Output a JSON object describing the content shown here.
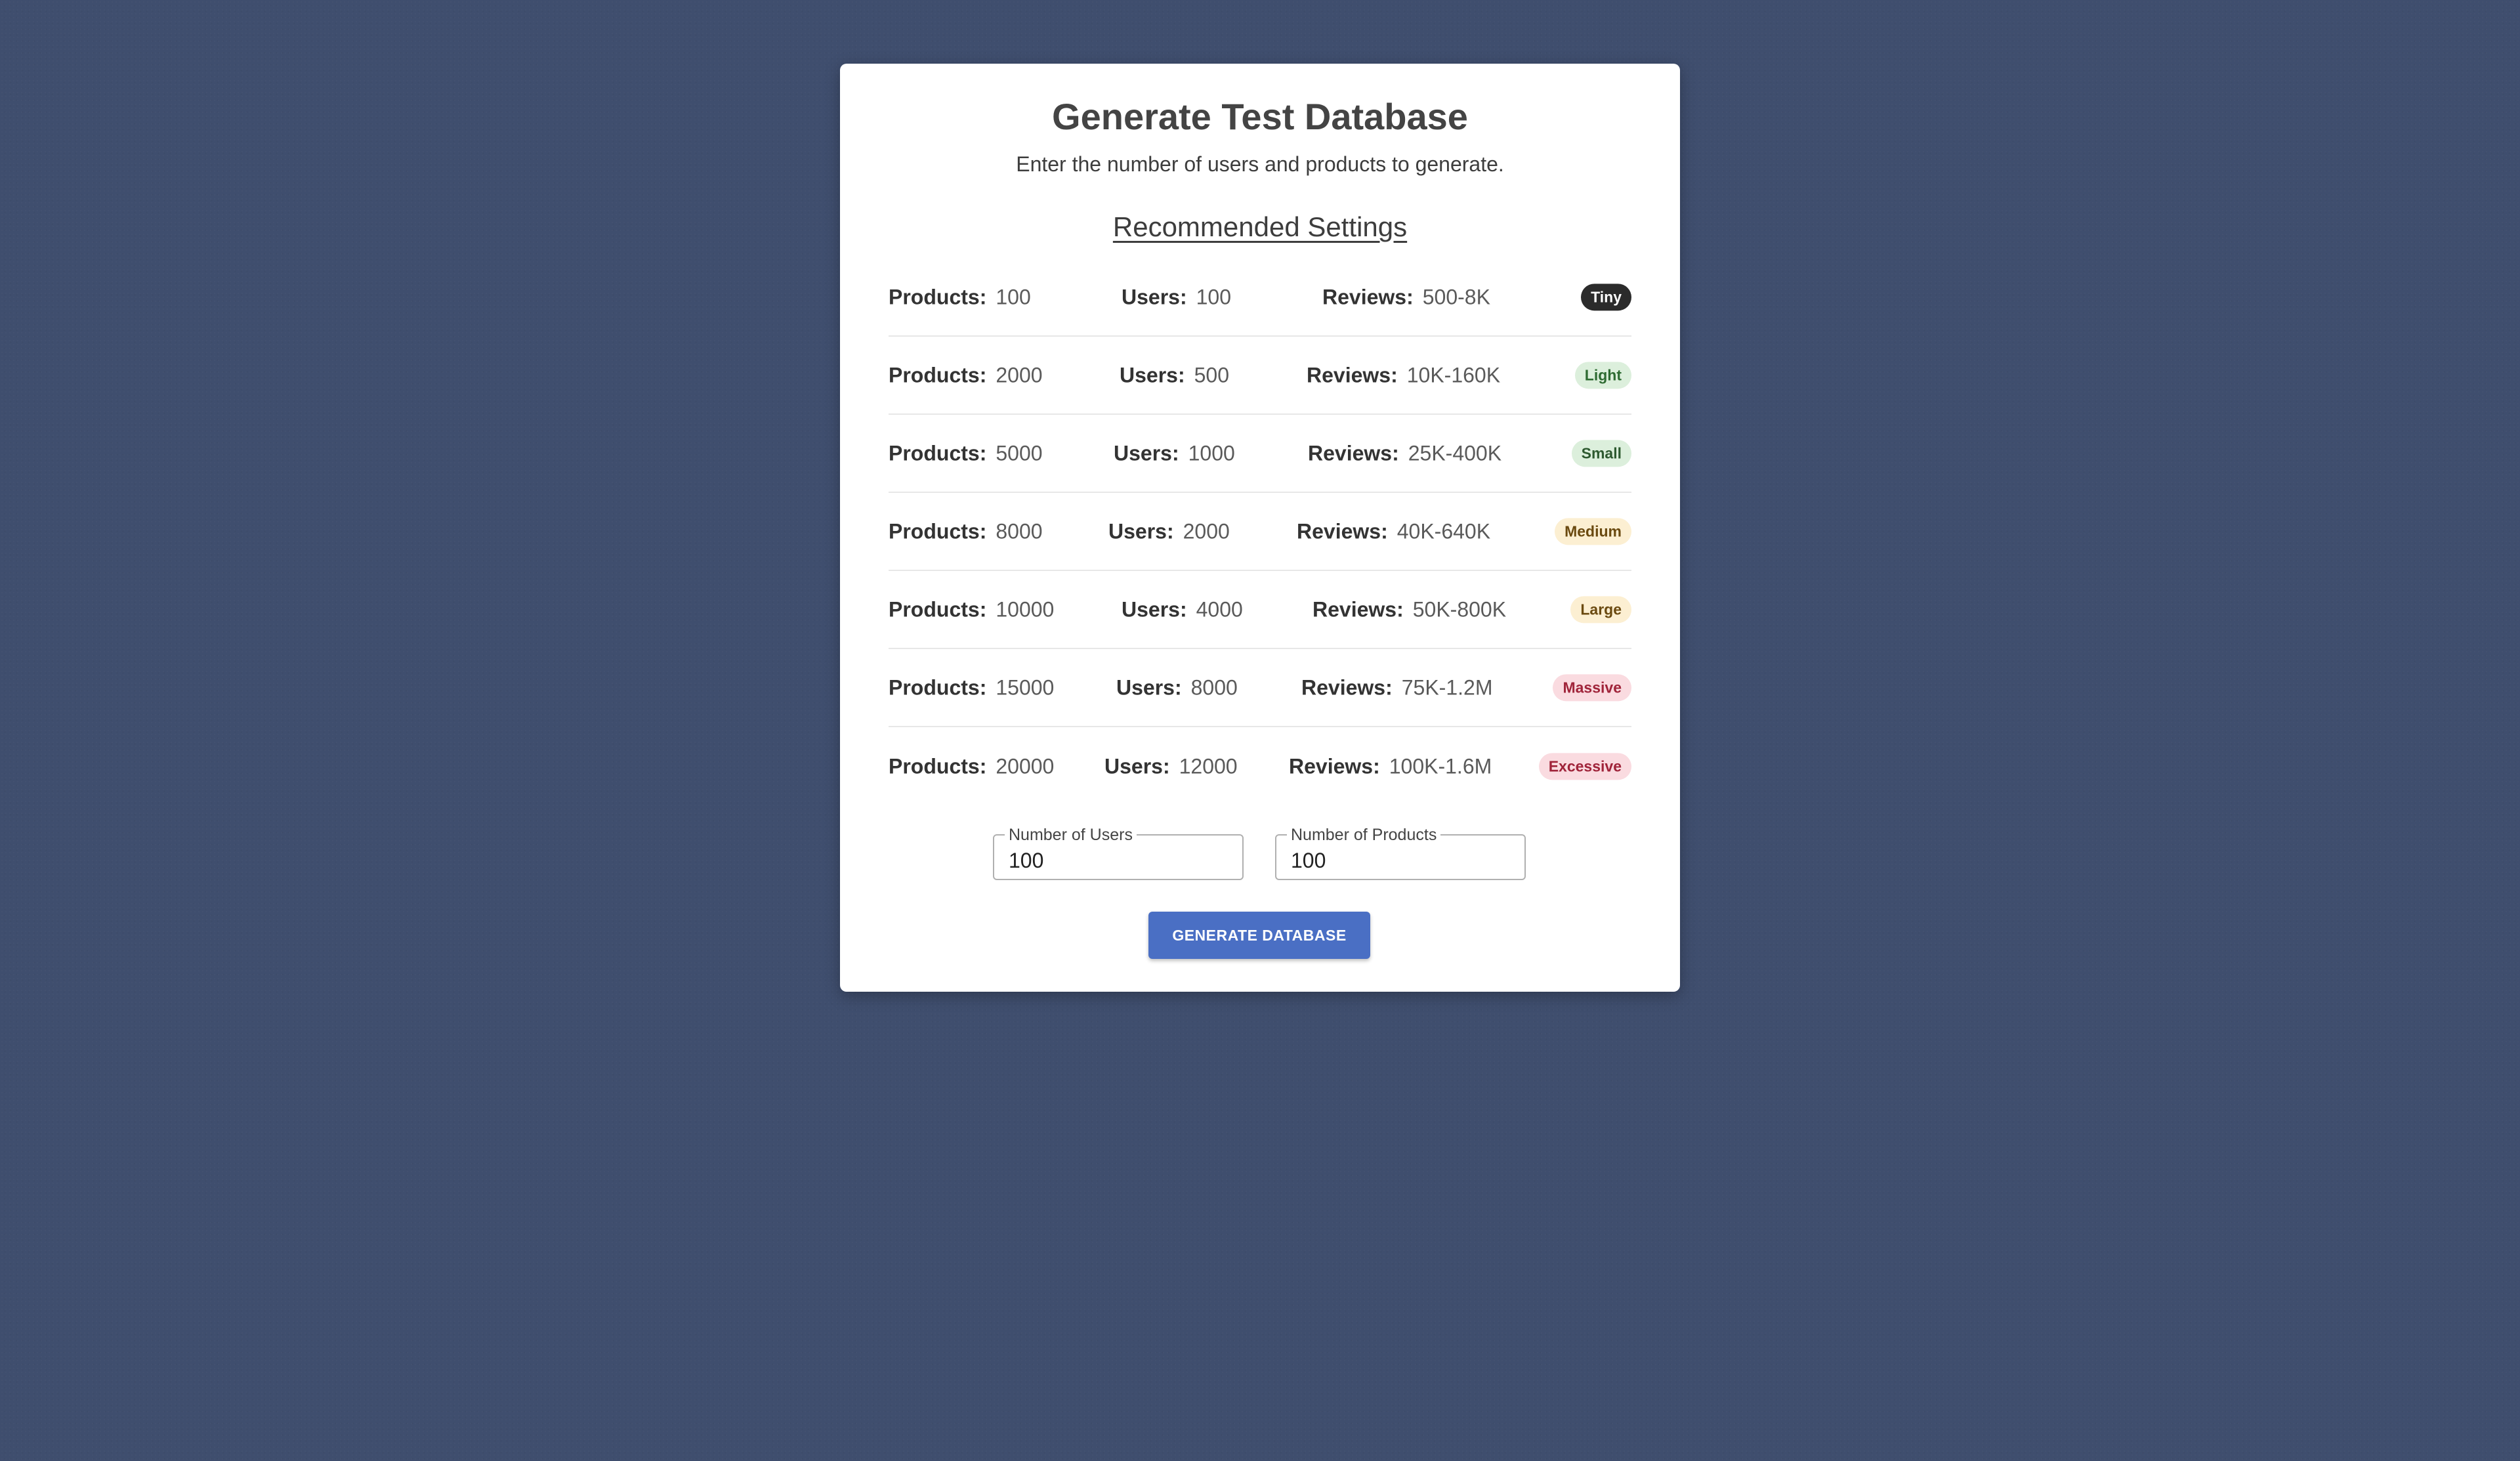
{
  "page": {
    "title": "Generate Test Database",
    "subtitle": "Enter the number of users and products to generate.",
    "section_title": "Recommended Settings"
  },
  "labels": {
    "products": "Products:",
    "users": "Users:",
    "reviews": "Reviews:"
  },
  "settings": [
    {
      "products": "100",
      "users": "100",
      "reviews": "500-8K",
      "size": "Tiny",
      "badge_bg": "#2b2b2b",
      "badge_fg": "#ffffff"
    },
    {
      "products": "2000",
      "users": "500",
      "reviews": "10K-160K",
      "size": "Light",
      "badge_bg": "#dcefdc",
      "badge_fg": "#2e6b32"
    },
    {
      "products": "5000",
      "users": "1000",
      "reviews": "25K-400K",
      "size": "Small",
      "badge_bg": "#dcefdc",
      "badge_fg": "#2e5a30"
    },
    {
      "products": "8000",
      "users": "2000",
      "reviews": "40K-640K",
      "size": "Medium",
      "badge_bg": "#fcefd2",
      "badge_fg": "#6b4a10"
    },
    {
      "products": "10000",
      "users": "4000",
      "reviews": "50K-800K",
      "size": "Large",
      "badge_bg": "#fcefd2",
      "badge_fg": "#6b4a10"
    },
    {
      "products": "15000",
      "users": "8000",
      "reviews": "75K-1.2M",
      "size": "Massive",
      "badge_bg": "#fadbe0",
      "badge_fg": "#a0243a"
    },
    {
      "products": "20000",
      "users": "12000",
      "reviews": "100K-1.6M",
      "size": "Excessive",
      "badge_bg": "#fadbe0",
      "badge_fg": "#a0243a"
    }
  ],
  "form": {
    "users_label": "Number of Users",
    "users_value": "100",
    "products_label": "Number of Products",
    "products_value": "100",
    "submit_label": "GENERATE DATABASE"
  }
}
